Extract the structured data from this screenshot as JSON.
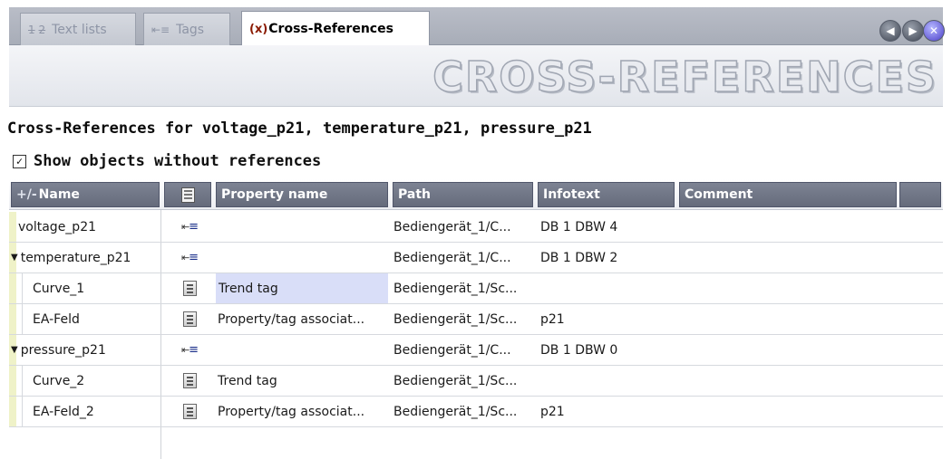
{
  "tabs": [
    {
      "label": "Text lists",
      "icon": "text-list-icon",
      "glyph": "1-\n2-"
    },
    {
      "label": "Tags",
      "icon": "tag-icon",
      "glyph": "⇤≡"
    },
    {
      "label": "Cross-References",
      "icon": "cross-reference-icon",
      "glyph": "(x)"
    }
  ],
  "nav": {
    "prev": "◀",
    "next": "▶",
    "close": "✕"
  },
  "banner_title": "CROSS-REFERENCES",
  "references_heading": "Cross-References for voltage_p21, temperature_p21, pressure_p21",
  "show_objects": {
    "checked": true,
    "mark": "✓",
    "label": "Show objects without references"
  },
  "columns": {
    "toggle": "+/-",
    "name": "Name",
    "property_name": "Property name",
    "path": "Path",
    "infotext": "Infotext",
    "comment": "Comment"
  },
  "rows": [
    {
      "name": "voltage_p21",
      "icon": "tag-icon",
      "property": "",
      "path": "Bediengerät_1/C...",
      "infotext": "DB 1 DBW 4",
      "expanded": null
    },
    {
      "name": "temperature_p21",
      "icon": "tag-icon",
      "property": "",
      "path": "Bediengerät_1/C...",
      "infotext": "DB 1 DBW 2",
      "expanded": "▼"
    },
    {
      "name": "Curve_1",
      "icon": "screen-object-icon",
      "property": "Trend tag",
      "path": "Bediengerät_1/Sc...",
      "infotext": "",
      "selected": true
    },
    {
      "name": "EA-Feld",
      "icon": "screen-object-icon",
      "property": "Property/tag associat...",
      "path": "Bediengerät_1/Sc...",
      "infotext": "p21"
    },
    {
      "name": "pressure_p21",
      "icon": "tag-icon",
      "property": "",
      "path": "Bediengerät_1/C...",
      "infotext": "DB 1 DBW 0",
      "expanded": "▼"
    },
    {
      "name": "Curve_2",
      "icon": "screen-object-icon",
      "property": "Trend tag",
      "path": "Bediengerät_1/Sc...",
      "infotext": ""
    },
    {
      "name": "EA-Feld_2",
      "icon": "screen-object-icon",
      "property": "Property/tag associat...",
      "path": "Bediengerät_1/Sc...",
      "infotext": "p21"
    }
  ],
  "colors": {
    "header_bg": "#6f7587",
    "selection": "#d9def8",
    "gutter": "#eff2c8"
  }
}
